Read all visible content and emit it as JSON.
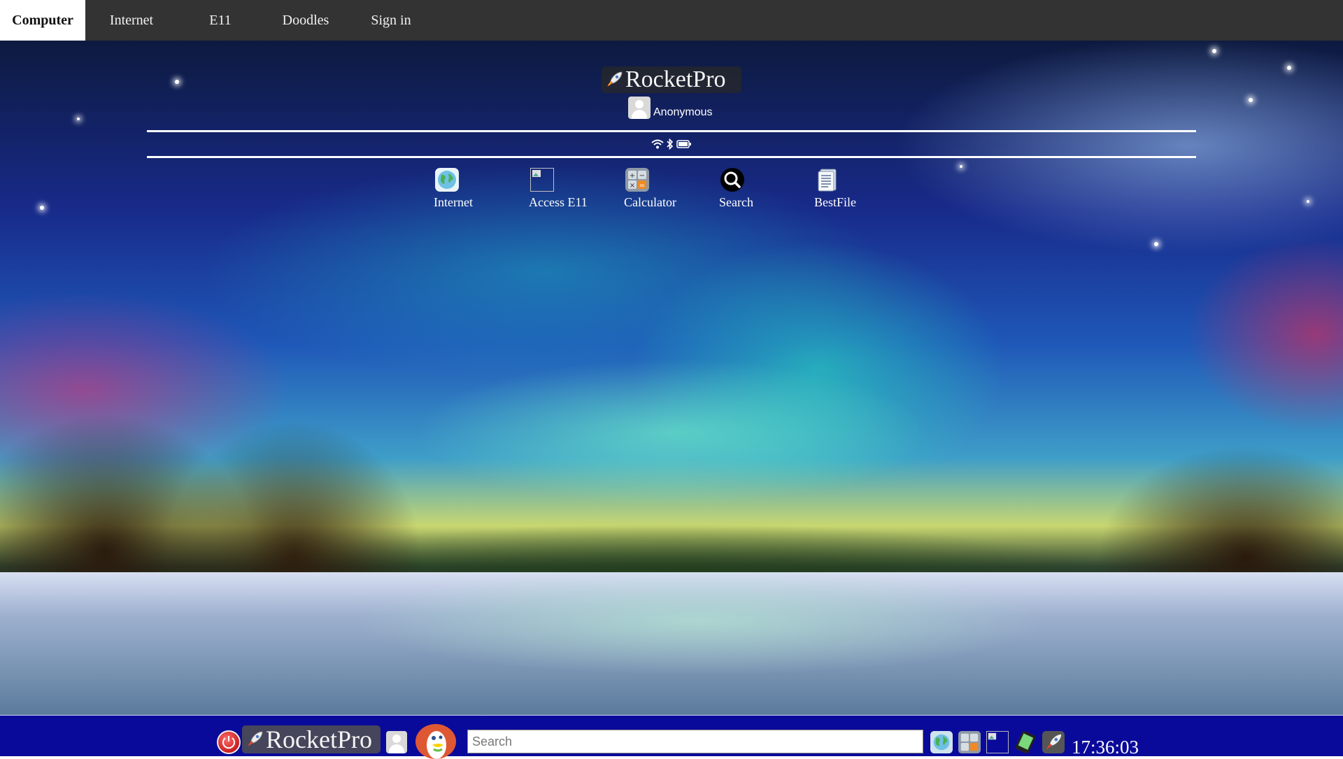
{
  "nav": {
    "tabs": [
      {
        "label": "Computer",
        "active": true
      },
      {
        "label": "Internet"
      },
      {
        "label": "E11"
      },
      {
        "label": "Doodles"
      },
      {
        "label": "Sign in"
      }
    ]
  },
  "desktop": {
    "logo_text": "RocketPro",
    "user_name": "Anonymous",
    "status_icons": [
      "wifi-icon",
      "bluetooth-icon",
      "battery-icon"
    ],
    "apps": [
      {
        "label": "Internet",
        "icon": "globe-icon"
      },
      {
        "label": "Access E11",
        "icon": "broken-image-icon"
      },
      {
        "label": "Calculator",
        "icon": "calculator-icon"
      },
      {
        "label": "Search",
        "icon": "magnifier-icon"
      },
      {
        "label": "BestFile",
        "icon": "document-icon"
      }
    ]
  },
  "taskbar": {
    "logo_text": "RocketPro",
    "search_placeholder": "Search",
    "clock": "17:36:03",
    "pinned_icons": [
      "globe-icon",
      "calculator-icon",
      "broken-image-icon",
      "phone-icon",
      "rocket-icon"
    ]
  },
  "colors": {
    "nav_bg": "#333333",
    "taskbar_bg": "#0a0a9a"
  }
}
